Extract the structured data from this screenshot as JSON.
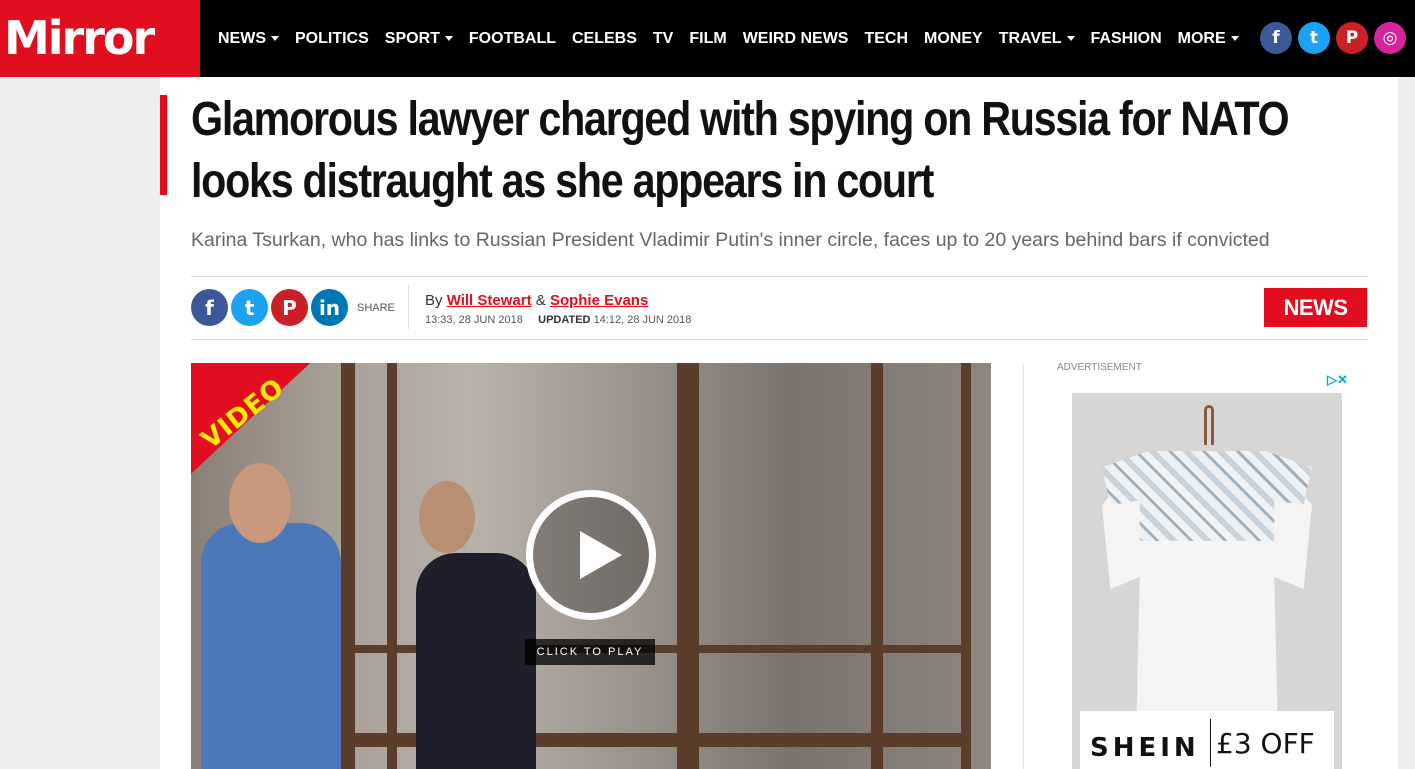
{
  "brand": {
    "logo_text": "Mirror"
  },
  "nav": {
    "items": [
      {
        "label": "NEWS",
        "dropdown": true
      },
      {
        "label": "POLITICS",
        "dropdown": false
      },
      {
        "label": "SPORT",
        "dropdown": true
      },
      {
        "label": "FOOTBALL",
        "dropdown": false
      },
      {
        "label": "CELEBS",
        "dropdown": false
      },
      {
        "label": "TV",
        "dropdown": false
      },
      {
        "label": "FILM",
        "dropdown": false
      },
      {
        "label": "WEIRD NEWS",
        "dropdown": false
      },
      {
        "label": "TECH",
        "dropdown": false
      },
      {
        "label": "MONEY",
        "dropdown": false
      },
      {
        "label": "TRAVEL",
        "dropdown": true
      },
      {
        "label": "FASHION",
        "dropdown": false
      },
      {
        "label": "MORE",
        "dropdown": true
      }
    ]
  },
  "header_social": {
    "icons": [
      "facebook-icon",
      "twitter-icon",
      "pinterest-icon",
      "instagram-icon"
    ]
  },
  "article": {
    "headline": "Glamorous lawyer charged with spying on Russia for NATO looks distraught as she appears in court",
    "subheadline": "Karina Tsurkan, who has links to Russian President Vladimir Putin's inner circle, faces up to 20 years behind bars if convicted",
    "share_label": "SHARE",
    "byline_prefix": "By",
    "author1": "Will Stewart",
    "author_sep": "&",
    "author2": "Sophie Evans",
    "published": "13:33, 28 JUN 2018",
    "updated_label": "UPDATED",
    "updated": "14:12, 28 JUN 2018",
    "section_badge": "NEWS"
  },
  "video": {
    "ribbon": "VIDEO",
    "play_label": "CLICK TO PLAY"
  },
  "ad": {
    "label": "ADVERTISEMENT",
    "adchoices": "▷✕",
    "brand": "SHEIN",
    "offer": "£3 OFF"
  },
  "colors": {
    "brand_red": "#e10e1f",
    "nav_bg": "#000000"
  }
}
